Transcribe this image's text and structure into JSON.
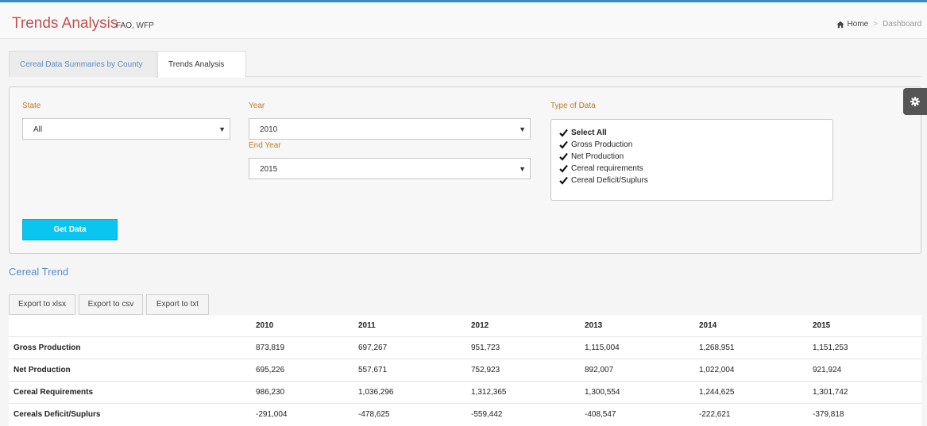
{
  "header": {
    "title": "Trends Analysis",
    "subtitle": "FAO, WFP",
    "breadcrumb": {
      "home": "Home",
      "separator": ">",
      "current": "Dashboard"
    }
  },
  "tabs": [
    {
      "label": "Cereal Data Summaries by County",
      "active": false
    },
    {
      "label": "Trends Analysis",
      "active": true
    }
  ],
  "filters": {
    "state_label": "State",
    "state_value": "All",
    "year_label": "Year",
    "year_value": "2010",
    "end_year_label": "End Year",
    "end_year_value": "2015",
    "type_label": "Type of Data",
    "types": [
      {
        "label": "Select All",
        "checked": true
      },
      {
        "label": "Gross Production",
        "checked": true
      },
      {
        "label": "Net Production",
        "checked": true
      },
      {
        "label": "Cereal requirements",
        "checked": true
      },
      {
        "label": "Cereal Deficit/Suplurs",
        "checked": true
      }
    ],
    "get_data_label": "Get Data"
  },
  "section": {
    "title": "Cereal Trend"
  },
  "exports": [
    "Export to xlsx",
    "Export to csv",
    "Export to txt"
  ],
  "table": {
    "columns": [
      "",
      "2010",
      "2011",
      "2012",
      "2013",
      "2014",
      "2015"
    ],
    "rows": [
      {
        "label": "Gross Production",
        "values": [
          "873,819",
          "697,267",
          "951,723",
          "1,115,004",
          "1,268,951",
          "1,151,253"
        ]
      },
      {
        "label": "Net Production",
        "values": [
          "695,226",
          "557,671",
          "752,923",
          "892,007",
          "1,022,004",
          "921,924"
        ]
      },
      {
        "label": "Cereal Requirements",
        "values": [
          "986,230",
          "1,036,296",
          "1,312,365",
          "1,300,554",
          "1,244,625",
          "1,301,742"
        ]
      },
      {
        "label": "Cereals Deficit/Suplurs",
        "values": [
          "-291,004",
          "-478,625",
          "-559,442",
          "-408,547",
          "-222,621",
          "-379,818"
        ]
      }
    ]
  },
  "colors": {
    "accent": "#3c8dbc",
    "title": "#c0504d",
    "link": "#5a8fc7",
    "button": "#0ac5f0",
    "label": "#c07a2a"
  },
  "icons": {
    "home": "home-icon",
    "gear": "gear-icon",
    "caret": "caret-down-icon",
    "check": "check-icon"
  }
}
